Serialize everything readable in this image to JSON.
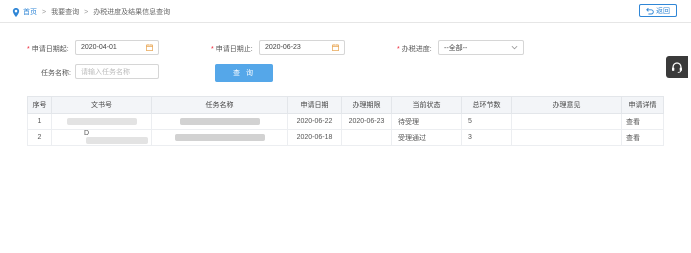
{
  "breadcrumb": {
    "home": "首页",
    "level1": "我要查询",
    "current": "办税进度及结果信息查询",
    "separator": ">"
  },
  "back_button": {
    "label": "返回",
    "icon": "return-arrow-icon"
  },
  "filters": {
    "date_from": {
      "label": "申请日期起:",
      "value": "2020-04-01",
      "icon": "calendar-icon"
    },
    "date_to": {
      "label": "申请日期止:",
      "value": "2020-06-23",
      "icon": "calendar-icon"
    },
    "progress": {
      "label": "办税进度:",
      "value": "--全部--",
      "icon": "chevron-down-icon"
    },
    "task_name": {
      "label": "任务名称:",
      "placeholder": "请输入任务名称",
      "value": ""
    },
    "query_button": "查 询"
  },
  "side_float": {
    "icon": "headset-support-icon"
  },
  "table": {
    "columns": [
      "序号",
      "文书号",
      "任务名称",
      "申请日期",
      "办理期限",
      "当前状态",
      "总环节数",
      "办理意见",
      "申请详情"
    ],
    "rows": [
      {
        "index": "1",
        "doc_no": "",
        "task_name": "",
        "apply_date": "2020-06-22",
        "deadline": "2020-06-23",
        "status": "待受理",
        "steps": "5",
        "opinion": "",
        "detail": "查看"
      },
      {
        "index": "2",
        "doc_no": "D",
        "task_name": "",
        "apply_date": "2020-06-18",
        "deadline": "",
        "status": "受理通过",
        "steps": "3",
        "opinion": "",
        "detail": "查看"
      }
    ]
  },
  "colors": {
    "link": "#2f86d6",
    "query_button": "#55a7e9",
    "required": "#e22233",
    "side_float": "#3a3a3a"
  }
}
